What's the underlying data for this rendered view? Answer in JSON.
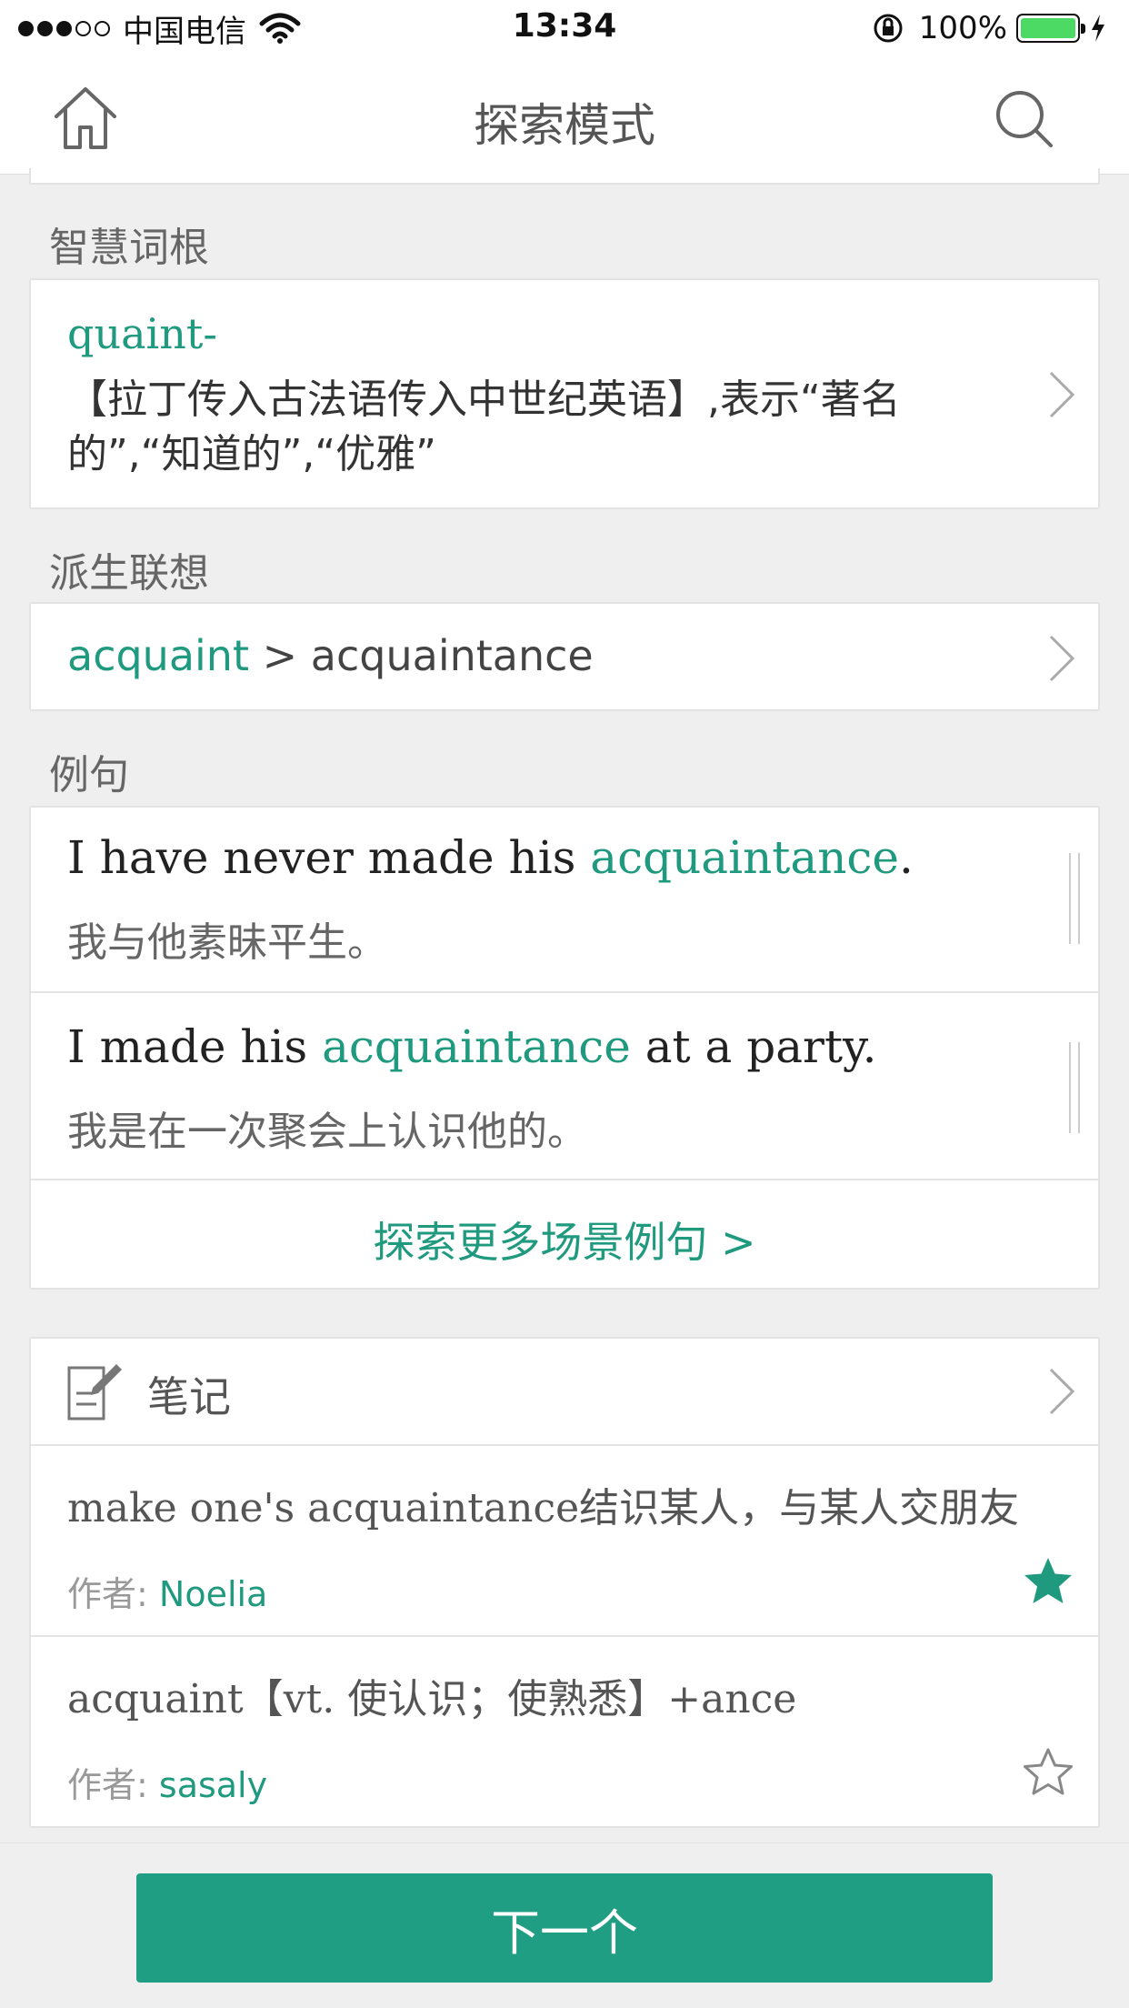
{
  "status_bar": {
    "carrier": "中国电信",
    "time": "13:34",
    "battery": "100%",
    "battery_level": 1.0
  },
  "nav": {
    "title": "探索模式",
    "home_icon": "home-icon",
    "search_icon": "search-icon"
  },
  "sections": {
    "root": {
      "label": "智慧词根",
      "word": "quaint-",
      "description": "【拉丁传入古法语传入中世纪英语】,表示“著名的”,“知道的”,“优雅”"
    },
    "derivation": {
      "label": "派生联想",
      "base": "acquaint",
      "separator": " > ",
      "derived": "acquaintance"
    },
    "examples": {
      "label": "例句",
      "items": [
        {
          "en_before": "I have never made his ",
          "en_highlight": "acquaintance",
          "en_after": ".",
          "zh": "我与他素昧平生。"
        },
        {
          "en_before": "I made his ",
          "en_highlight": "acquaintance",
          "en_after": " at a party.",
          "zh": "我是在一次聚会上认识他的。"
        }
      ],
      "more_link": "探索更多场景例句 >"
    },
    "notes": {
      "title": "笔记",
      "author_prefix": "作者: ",
      "items": [
        {
          "text": "make one's acquaintance结识某人，与某人交朋友",
          "author": "Noelia",
          "starred": true
        },
        {
          "text": "acquaint【vt. 使认识；使熟悉】+ance",
          "author": "sasaly",
          "starred": false
        }
      ]
    }
  },
  "footer": {
    "next_button": "下一个"
  },
  "colors": {
    "accent": "#1f9a7f",
    "button": "#1f9e83",
    "background": "#efefef"
  }
}
